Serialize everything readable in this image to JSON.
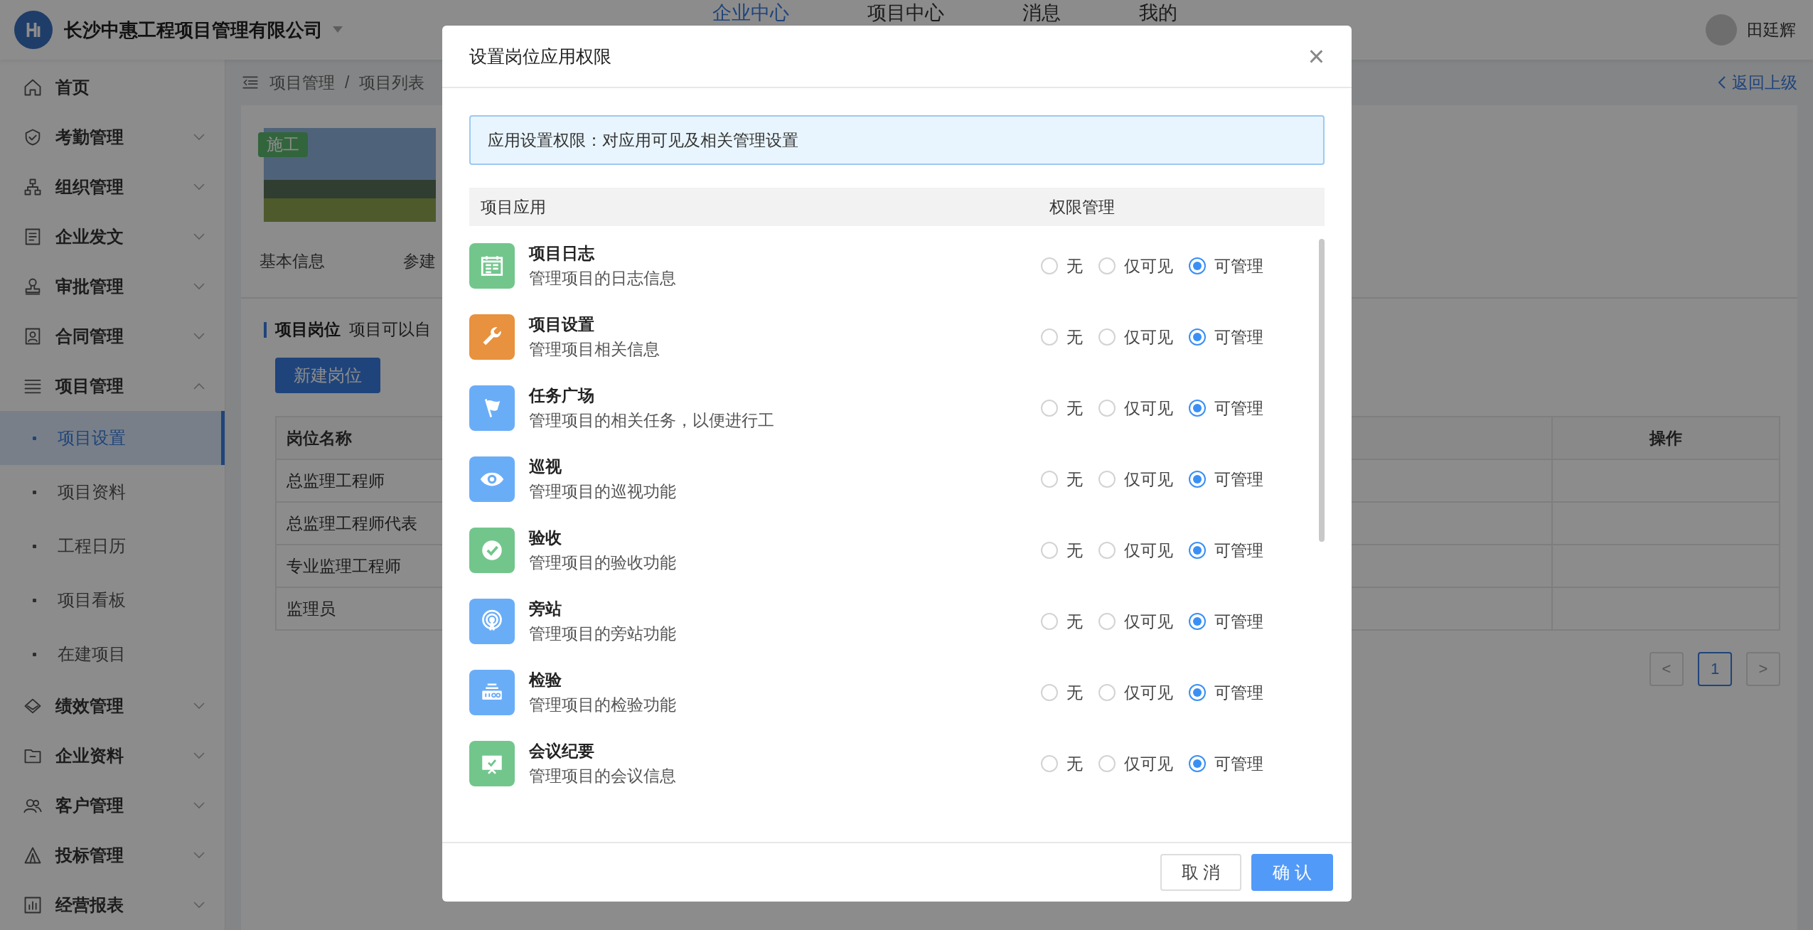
{
  "header": {
    "company": "长沙中惠工程项目管理有限公司",
    "nav": [
      {
        "label": "企业中心",
        "selected": true
      },
      {
        "label": "项目中心",
        "selected": false
      },
      {
        "label": "消息",
        "selected": false
      },
      {
        "label": "我的",
        "selected": false
      }
    ],
    "user": "田廷辉"
  },
  "sidebar": {
    "items": [
      {
        "label": "首页",
        "kind": "home"
      },
      {
        "label": "考勤管理",
        "kind": "shield",
        "expanded": false
      },
      {
        "label": "组织管理",
        "kind": "org",
        "expanded": false
      },
      {
        "label": "企业发文",
        "kind": "doc",
        "expanded": false
      },
      {
        "label": "审批管理",
        "kind": "stamp",
        "expanded": false
      },
      {
        "label": "合同管理",
        "kind": "contract",
        "expanded": false
      },
      {
        "label": "项目管理",
        "kind": "list",
        "expanded": true,
        "children": [
          {
            "label": "项目设置",
            "selected": true
          },
          {
            "label": "项目资料",
            "selected": false
          },
          {
            "label": "工程日历",
            "selected": false
          },
          {
            "label": "项目看板",
            "selected": false
          },
          {
            "label": "在建项目",
            "selected": false
          }
        ]
      },
      {
        "label": "绩效管理",
        "kind": "diamond",
        "expanded": false
      },
      {
        "label": "企业资料",
        "kind": "folder",
        "expanded": false
      },
      {
        "label": "客户管理",
        "kind": "users",
        "expanded": false
      },
      {
        "label": "投标管理",
        "kind": "bid",
        "expanded": false
      },
      {
        "label": "经营报表",
        "kind": "chart",
        "expanded": false
      }
    ]
  },
  "breadcrumb": [
    "项目管理",
    "/",
    "项目列表"
  ],
  "back_link": "返回上级",
  "project": {
    "tag": "施工",
    "tabs": [
      "基本信息",
      "参建"
    ]
  },
  "section": {
    "title": "项目岗位",
    "description": "项目可以自",
    "new_button": "新建岗位"
  },
  "table": {
    "columns": [
      "岗位名称",
      "操作"
    ],
    "rows": [
      "总监理工程师",
      "总监理工程师代表",
      "专业监理工程师",
      "监理员"
    ]
  },
  "pagination": {
    "prev": "<",
    "pages": [
      {
        "label": "1",
        "selected": true
      }
    ],
    "next": ">"
  },
  "dialog": {
    "title": "设置岗位应用权限",
    "close": "×",
    "notice": "应用设置权限：对应用可见及相关管理设置",
    "columns": [
      "项目应用",
      "权限管理"
    ],
    "apps": [
      {
        "name": "项目日志",
        "description": "管理项目的日志信息",
        "kind": "calendar",
        "color": "#72c68c",
        "options": [
          {
            "label": "无",
            "selected": false
          },
          {
            "label": "仅可见",
            "selected": false
          },
          {
            "label": "可管理",
            "selected": true
          }
        ]
      },
      {
        "name": "项目设置",
        "description": "管理项目相关信息",
        "kind": "wrench",
        "color": "#e8913e",
        "options": [
          {
            "label": "无",
            "selected": false
          },
          {
            "label": "仅可见",
            "selected": false
          },
          {
            "label": "可管理",
            "selected": true
          }
        ]
      },
      {
        "name": "任务广场",
        "description": "管理项目的相关任务，以便进行工",
        "kind": "flag",
        "color": "#6aadf7",
        "options": [
          {
            "label": "无",
            "selected": false
          },
          {
            "label": "仅可见",
            "selected": false
          },
          {
            "label": "可管理",
            "selected": true
          }
        ]
      },
      {
        "name": "巡视",
        "description": "管理项目的巡视功能",
        "kind": "eye",
        "color": "#6aadf7",
        "options": [
          {
            "label": "无",
            "selected": false
          },
          {
            "label": "仅可见",
            "selected": false
          },
          {
            "label": "可管理",
            "selected": true
          }
        ]
      },
      {
        "name": "验收",
        "description": "管理项目的验收功能",
        "kind": "check",
        "color": "#72c68c",
        "options": [
          {
            "label": "无",
            "selected": false
          },
          {
            "label": "仅可见",
            "selected": false
          },
          {
            "label": "可管理",
            "selected": true
          }
        ]
      },
      {
        "name": "旁站",
        "description": "管理项目的旁站功能",
        "kind": "signal",
        "color": "#6aadf7",
        "options": [
          {
            "label": "无",
            "selected": false
          },
          {
            "label": "仅可见",
            "selected": false
          },
          {
            "label": "可管理",
            "selected": true
          }
        ]
      },
      {
        "name": "检验",
        "description": "管理项目的检验功能",
        "kind": "meter",
        "color": "#6aadf7",
        "options": [
          {
            "label": "无",
            "selected": false
          },
          {
            "label": "仅可见",
            "selected": false
          },
          {
            "label": "可管理",
            "selected": true
          }
        ]
      },
      {
        "name": "会议纪要",
        "description": "管理项目的会议信息",
        "kind": "board",
        "color": "#72c68c",
        "options": [
          {
            "label": "无",
            "selected": false
          },
          {
            "label": "仅可见",
            "selected": false
          },
          {
            "label": "可管理",
            "selected": true
          }
        ]
      }
    ],
    "buttons": [
      {
        "label": "取 消",
        "kind": "default"
      },
      {
        "label": "确 认",
        "kind": "primary"
      }
    ]
  }
}
